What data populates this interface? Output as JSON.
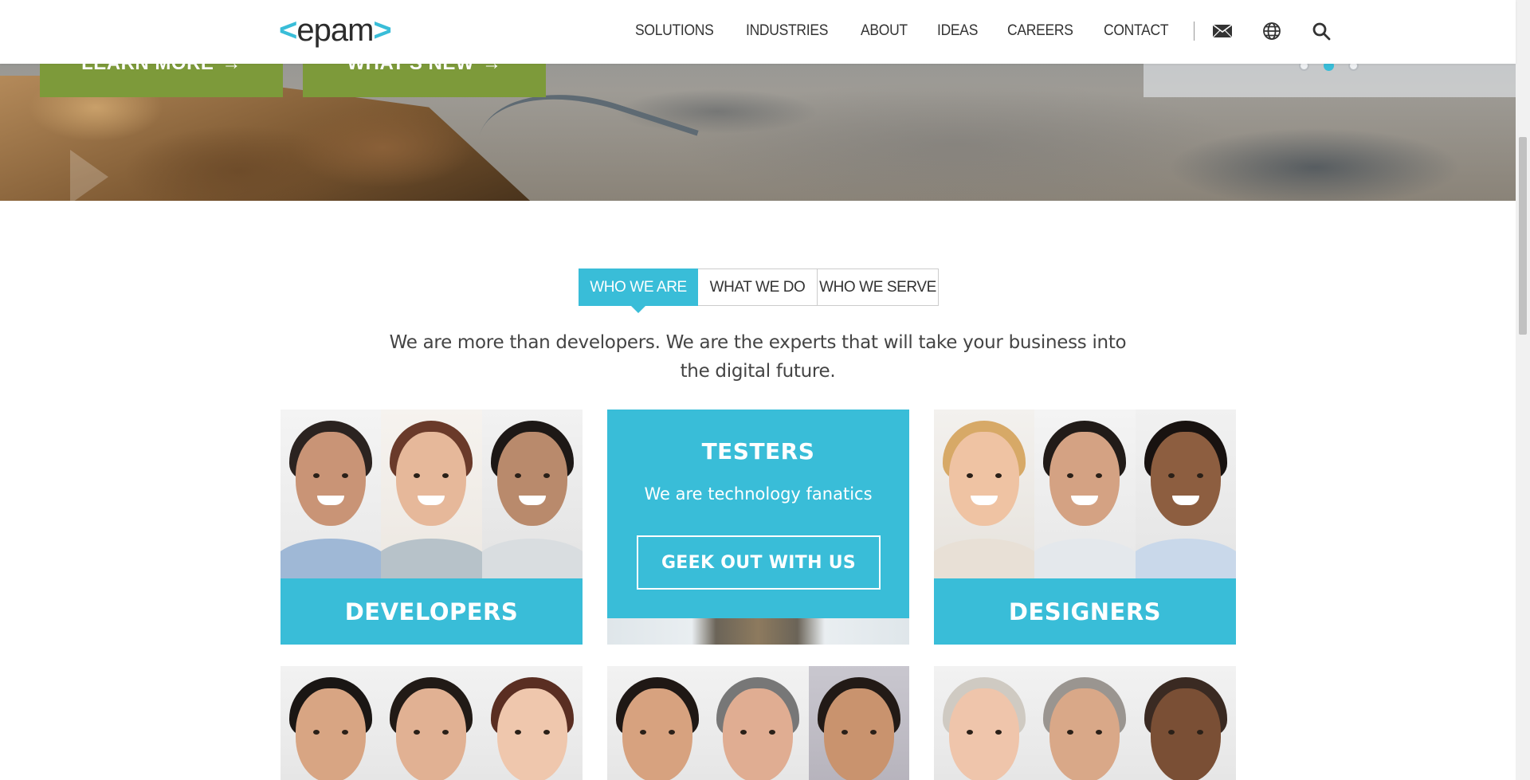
{
  "header": {
    "logo_text": "epam",
    "nav": [
      "SOLUTIONS",
      "INDUSTRIES",
      "ABOUT",
      "IDEAS",
      "CAREERS",
      "CONTACT"
    ],
    "icons": [
      "mail-icon",
      "globe-icon",
      "search-icon"
    ]
  },
  "hero": {
    "buttons": [
      {
        "label": "LEARN MORE",
        "arrow": "→"
      },
      {
        "label": "WHAT'S NEW",
        "arrow": "→"
      }
    ],
    "slides_total": 3,
    "slide_active": 2
  },
  "tabs": {
    "items": [
      "WHO WE ARE",
      "WHAT WE DO",
      "WHO WE SERVE"
    ],
    "active": "WHO WE ARE"
  },
  "intro": "We are more than developers. We are the experts that will take your business into the digital future.",
  "cards": {
    "developers": {
      "label": "DEVELOPERS"
    },
    "testers": {
      "title": "TESTERS",
      "subtitle": "We are technology fanatics",
      "button": "GEEK OUT WITH US"
    },
    "designers": {
      "label": "DESIGNERS"
    }
  },
  "colors": {
    "accent": "#39bdd8",
    "hero_button": "#7d9a3a",
    "text": "#333333"
  }
}
